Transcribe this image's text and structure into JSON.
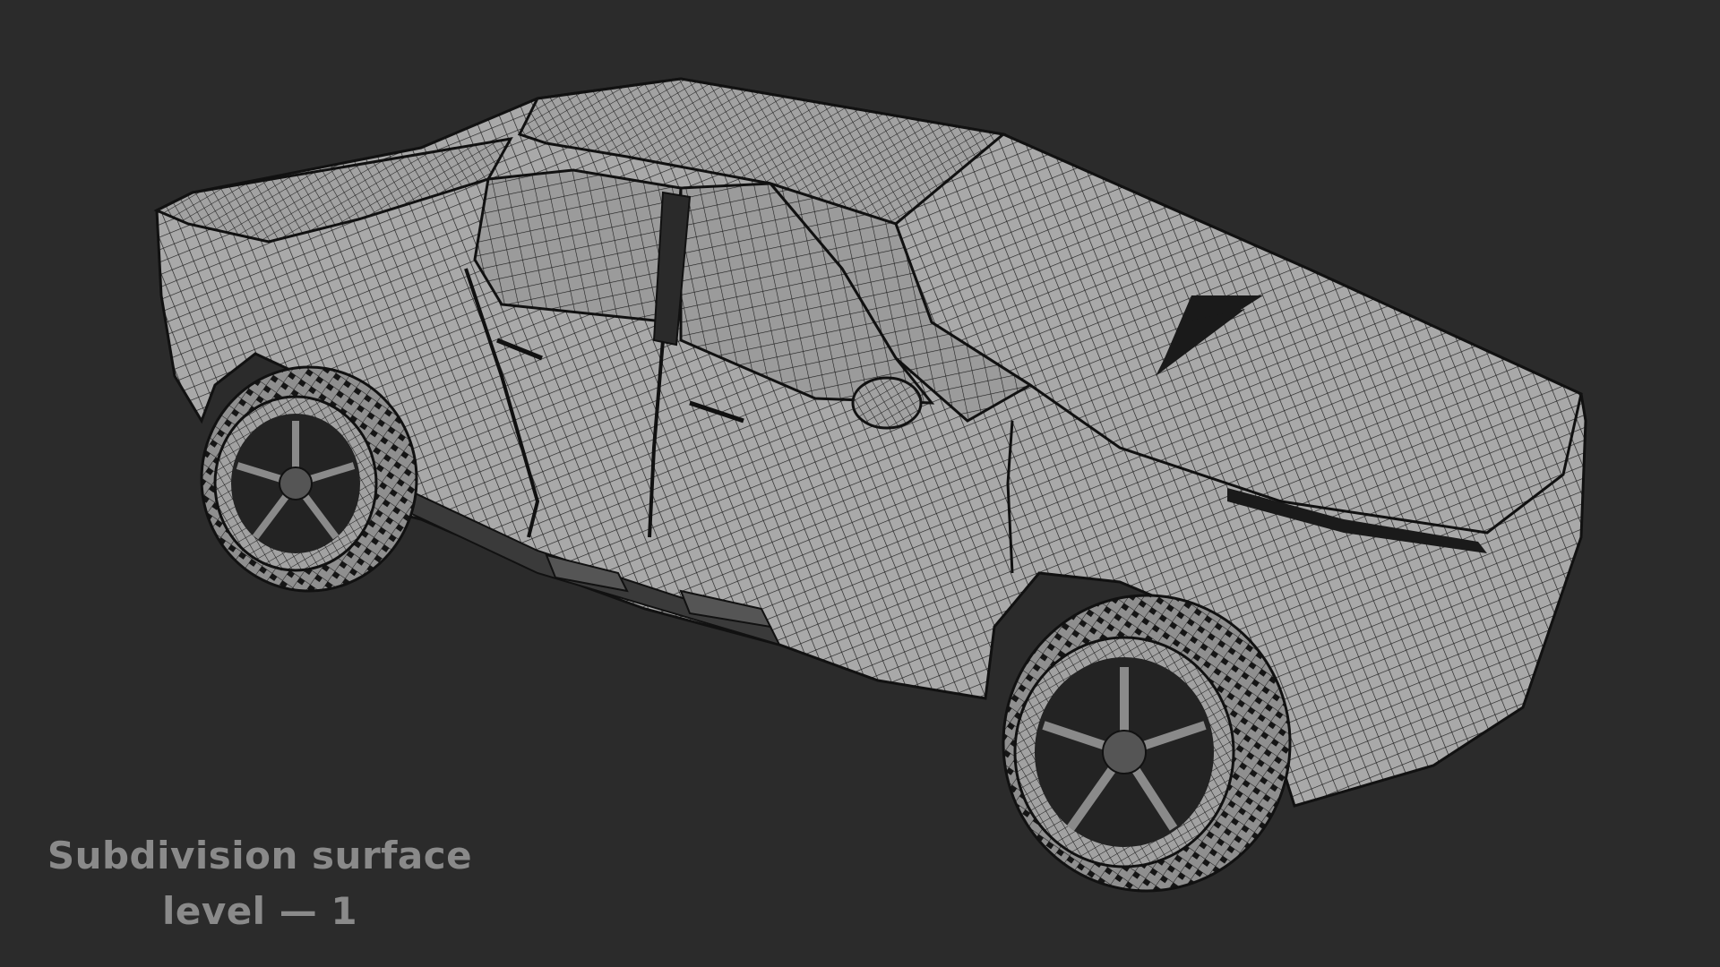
{
  "caption": {
    "line1": "Subdivision surface",
    "line2": "level — 1"
  },
  "render": {
    "background_color": "#2b2b2b",
    "surface_color": "#a9a9a9",
    "wire_color": "#1a1a1a",
    "caption_color": "#8a8a8a",
    "subject": "pickup-truck-wireframe-model"
  }
}
